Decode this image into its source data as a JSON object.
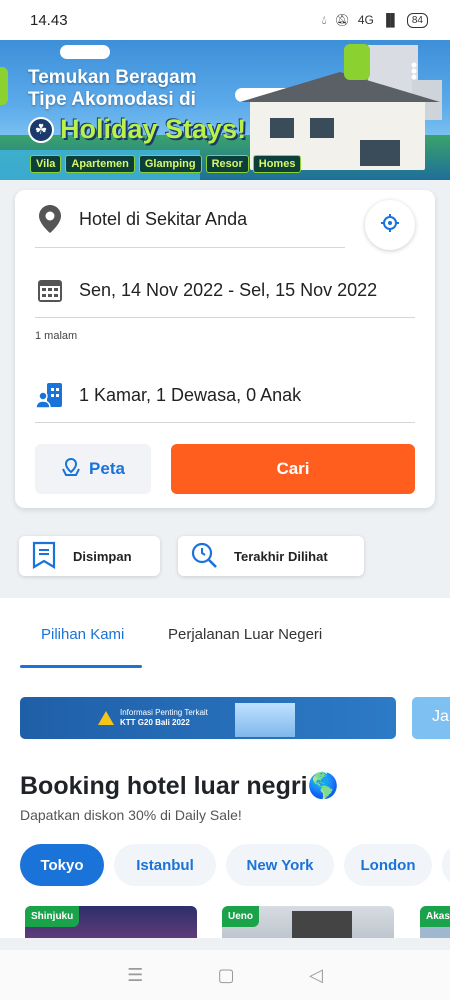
{
  "status_bar": {
    "time": "14.43",
    "network": "4G",
    "battery": "84"
  },
  "banner": {
    "line1": "Temukan Beragam",
    "line2": "Tipe Akomodasi di",
    "highlight": "Holiday Stays!",
    "chips": [
      "Vila",
      "Apartemen",
      "Glamping",
      "Resor",
      "Homes"
    ]
  },
  "search": {
    "location": "Hotel di Sekitar Anda",
    "dates": "Sen, 14 Nov 2022 - Sel, 15 Nov 2022",
    "nights": "1 malam",
    "guests": "1 Kamar, 1 Dewasa, 0 Anak",
    "map_label": "Peta",
    "search_label": "Cari"
  },
  "quick_actions": {
    "saved": "Disimpan",
    "recent": "Terakhir Dilihat"
  },
  "tabs": [
    "Pilihan Kami",
    "Perjalanan Luar Negeri"
  ],
  "info_banner": {
    "line1": "Informasi Penting Terkait",
    "line2": "KTT G20 Bali 2022",
    "next_peek": "Ja"
  },
  "section": {
    "title": "Booking hotel luar negri🌎",
    "subtitle": "Dapatkan diskon 30% di Daily Sale!",
    "cities": [
      "Tokyo",
      "Istanbul",
      "New York",
      "London"
    ]
  },
  "hotel_tags": [
    "Shinjuku",
    "Ueno",
    "Akas"
  ],
  "colors": {
    "primary": "#1a73d9",
    "cta": "#ff5e1f",
    "tag_green": "#1aa34a"
  }
}
